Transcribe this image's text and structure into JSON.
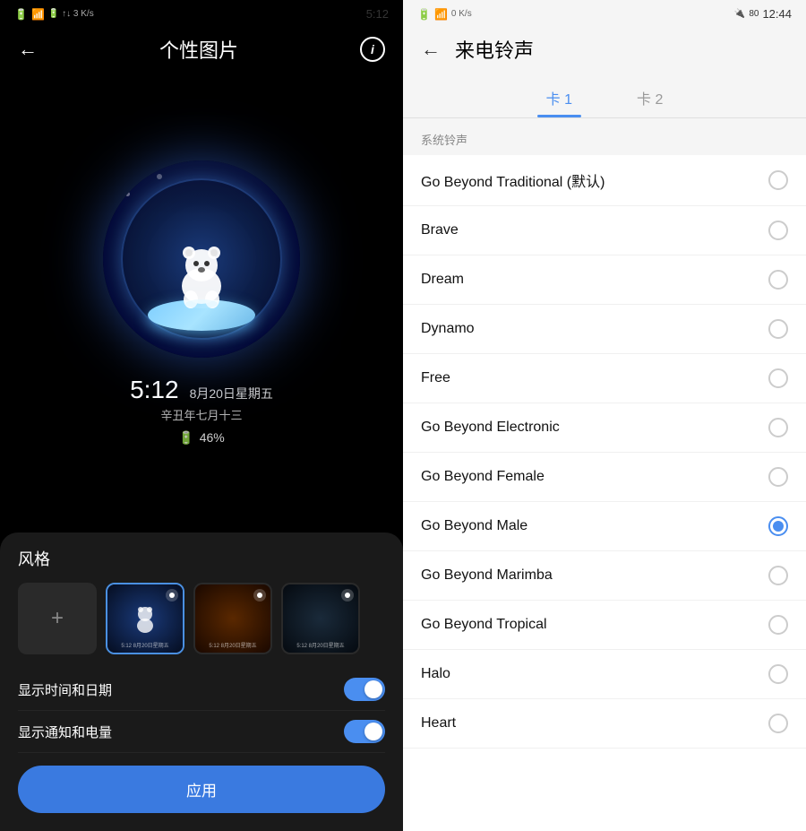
{
  "left": {
    "status": {
      "left": "🔋 ↑↓ 3 K/s",
      "time": "5:12"
    },
    "header": {
      "back_label": "←",
      "title": "个性图片"
    },
    "clock": {
      "time": "5:12",
      "date": "8月20日星期五",
      "lunar": "辛丑年七月十三",
      "battery": "46%"
    },
    "bottom": {
      "style_label": "风格",
      "toggle1_label": "显示时间和日期",
      "toggle2_label": "显示通知和电量",
      "apply_label": "应用"
    }
  },
  "right": {
    "status": {
      "left": "🔋 ↑↓ 0 K/s",
      "time": "12:44"
    },
    "header": {
      "back_label": "←",
      "title": "来电铃声"
    },
    "tabs": [
      {
        "label": "卡 1",
        "active": true
      },
      {
        "label": "卡 2",
        "active": false
      }
    ],
    "section_label": "系统铃声",
    "ringtones": [
      {
        "name": "Go Beyond Traditional (默认)",
        "selected": false
      },
      {
        "name": "Brave",
        "selected": false
      },
      {
        "name": "Dream",
        "selected": false
      },
      {
        "name": "Dynamo",
        "selected": false
      },
      {
        "name": "Free",
        "selected": false
      },
      {
        "name": "Go Beyond Electronic",
        "selected": false
      },
      {
        "name": "Go Beyond Female",
        "selected": false
      },
      {
        "name": "Go Beyond Male",
        "selected": true
      },
      {
        "name": "Go Beyond Marimba",
        "selected": false
      },
      {
        "name": "Go Beyond Tropical",
        "selected": false
      },
      {
        "name": "Halo",
        "selected": false
      },
      {
        "name": "Heart",
        "selected": false
      }
    ]
  }
}
